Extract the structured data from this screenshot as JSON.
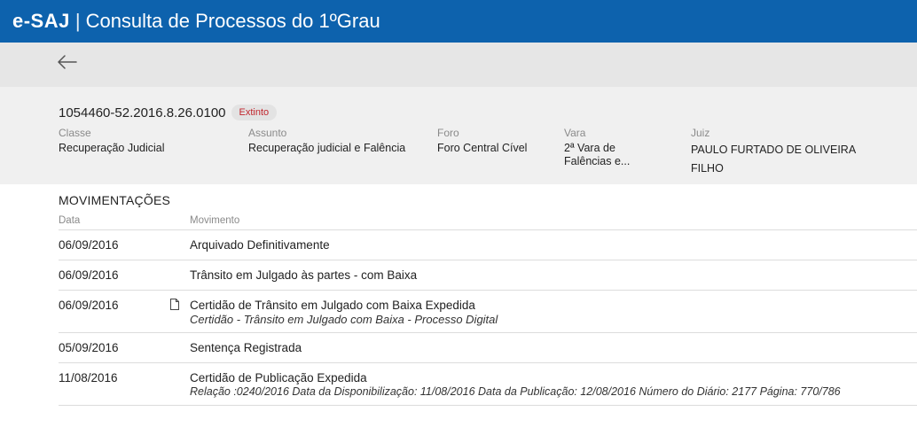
{
  "topbar": {
    "brand": "e-SAJ",
    "separator": "|",
    "title": "Consulta de Processos do 1ºGrau"
  },
  "icons": {
    "back": "arrow-left-icon",
    "document": "document-icon"
  },
  "colors": {
    "topbar": "#0d62ad",
    "badge_text": "#c0242c"
  },
  "process": {
    "number": "1054460-52.2016.8.26.0100",
    "status": "Extinto",
    "fields": {
      "classe": {
        "label": "Classe",
        "value": "Recuperação Judicial"
      },
      "assunto": {
        "label": "Assunto",
        "value": "Recuperação judicial e Falência"
      },
      "foro": {
        "label": "Foro",
        "value": "Foro Central Cível"
      },
      "vara": {
        "label": "Vara",
        "value_line1": "2ª Vara de",
        "value_line2": "Falências e..."
      },
      "juiz": {
        "label": "Juiz",
        "value_line1": "PAULO FURTADO DE OLIVEIRA",
        "value_line2": "FILHO"
      }
    }
  },
  "movimentacoes": {
    "title": "MOVIMENTAÇÕES",
    "headers": {
      "date": "Data",
      "movement": "Movimento"
    },
    "rows": [
      {
        "date": "06/09/2016",
        "main": "Arquivado Definitivamente",
        "sub": ""
      },
      {
        "date": "06/09/2016",
        "main": "Trânsito em Julgado às partes - com Baixa",
        "sub": ""
      },
      {
        "date": "06/09/2016",
        "main": "Certidão de Trânsito em Julgado com Baixa Expedida",
        "sub": "Certidão - Trânsito em Julgado com Baixa - Processo Digital",
        "has_document": true
      },
      {
        "date": "05/09/2016",
        "main": "Sentença Registrada",
        "sub": ""
      },
      {
        "date": "11/08/2016",
        "main": "Certidão de Publicação Expedida",
        "sub": "Relação :0240/2016 Data da Disponibilização: 11/08/2016 Data da Publicação: 12/08/2016 Número do Diário: 2177 Página: 770/786"
      }
    ]
  }
}
